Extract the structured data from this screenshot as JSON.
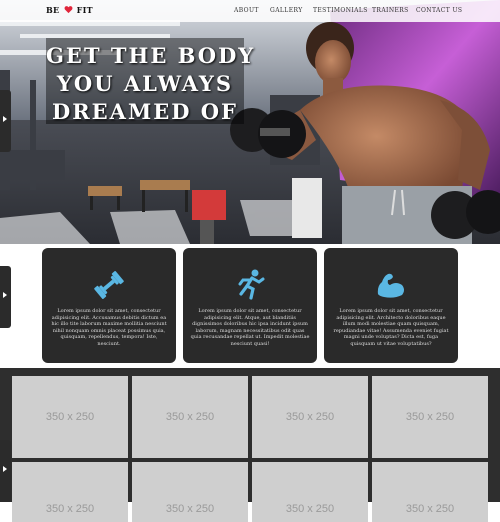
{
  "nav": {
    "logo_be": "BE",
    "logo_fit": "FIT",
    "items": [
      "ABOUT",
      "GALLERY",
      "TESTIMONIALS",
      "TRAINERS",
      "CONTACT US"
    ]
  },
  "hero": {
    "headline_lines": [
      "GET THE BODY",
      "YOU ALWAYS",
      "DREAMED OF"
    ]
  },
  "features": [
    {
      "icon": "dumbbell-icon",
      "text": "Lorem ipsum dolor sit amet, consectetur adipisicing elit. Accusamus debitis dictum ea hic illo tite laborum maxime mollitia nesciunt nihil nonquam omnis placeat possimus quia, quisquam, repellendus, tempora! Iste, nesciunt."
    },
    {
      "icon": "running-person-icon",
      "text": "Lorem ipsum dolor sit amet, consectetur adipisicing elit. Atque, aut blanditiis dignissimos doloribus hic ipsa incidunt ipsum laborum, magnam necessitatibus odit quas quia recusandae repellat ut. Impedit molestiae nesciunt quasi!"
    },
    {
      "icon": "flexed-arm-icon",
      "text": "Lorem ipsum dolor sit amet, consectetur adipisicing elit. Architecto doloribus eaque illum modi molestiae quam quisquam, repudiandae vitae! Assumenda eveniet fugiat magni unde voluptas? Dicta est, fuga quisquam ut vitae voluptatibus?"
    }
  ],
  "gallery": {
    "placeholder_label": "350 x 250",
    "row1": [
      "350 x 250",
      "350 x 250",
      "350 x 250",
      "350 x 250"
    ],
    "row2": [
      "350 x 250",
      "350 x 250",
      "350 x 250",
      "350 x 250"
    ]
  },
  "colors": {
    "accent_red": "#e0263b",
    "card_bg": "#2a2a2a",
    "icon_blue": "#5ab7e3",
    "gallery_bg": "#2e2e2e",
    "placeholder": "#cfcfcf"
  }
}
